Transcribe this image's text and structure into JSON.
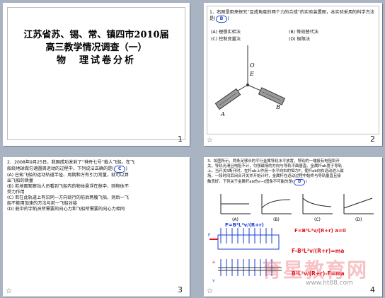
{
  "slide1": {
    "title_line1": "江苏省苏、锡、常、镇四市2010届",
    "title_line2": "高三教学情况调查（一）",
    "title_line3": "物　理试卷分析",
    "number": "1"
  },
  "slide2": {
    "question": "1．右图是用来探究“互成角度的两个力的合成”的实验装置图，本实验采用的科学方法是(",
    "answer": "B",
    "question_end": ")",
    "options": [
      "(A) 理想实验法",
      "(B) 等效替代法",
      "(C) 控制变量法",
      "(D) 极限法"
    ],
    "labels": {
      "O": "O",
      "E": "E",
      "A": "A",
      "B": "B"
    },
    "star": "☆",
    "number": "2"
  },
  "slide3": {
    "line1": "2．2008年9月25日，我国成功发射了“神舟七号”载人飞船，在飞",
    "line2": "船绕地球做匀速圆周运动的过程中，下列说法正确的是(",
    "answer": "C",
    "line2_end": ")",
    "options": [
      "(A) 已知飞船的运动轨道半径、周期和万有引力常量，就可以算",
      "出飞船的质量",
      "(B) 若地面观察站人员看到飞船内的物体悬浮在舱中，则物体不",
      "受力作用",
      "(C) 若在此轨道上有沿同一方向绕行的前后两艘飞船，则后一飞",
      "船不能用加速的方法与前一飞船对接",
      "(D) 舱中的宇航员所需要的向心力和飞船所需要的向心力相同"
    ],
    "star": "☆",
    "number": "3"
  },
  "slide4": {
    "text_lines": [
      "3．如图所示，两条足够长的平行金属导轨水平放置，导轨的一端接有电阻和开",
      "关，导轨光滑且电阻不计，匀强磁场的方向与导轨平面垂直。金属杆ab置于导轨",
      "上。当开关S断开时，在杆ab上作用一水平向右的恒力F，使杆ab向右运动进入磁",
      "场，一段时间后闭合开关并开始计时，金属杆在运动过程中始终与导轨垂直且接",
      "触良好。下列关于金属杆ab的v—t图象不可能的是("
    ],
    "answer": "D",
    "text_end": ")",
    "graph_labels": [
      "(A)",
      "(B)",
      "(C)",
      "(D)"
    ],
    "axis_v": "v",
    "axis_t": "t",
    "axis_o": "O",
    "eq1": "F=B²L²v/(R+r)",
    "eq2": "F=B²L²v/(R+r)   a=0",
    "eq3": "F-B²L²v/(R+r)=ma",
    "eq4": "B²L²v/(R+r)-F=ma",
    "label_F": "F",
    "label_a": "a",
    "label_v": "v",
    "star": "☆",
    "number": "4"
  },
  "watermark": {
    "text": "育星教育网",
    "url": "www.ht88.com"
  }
}
